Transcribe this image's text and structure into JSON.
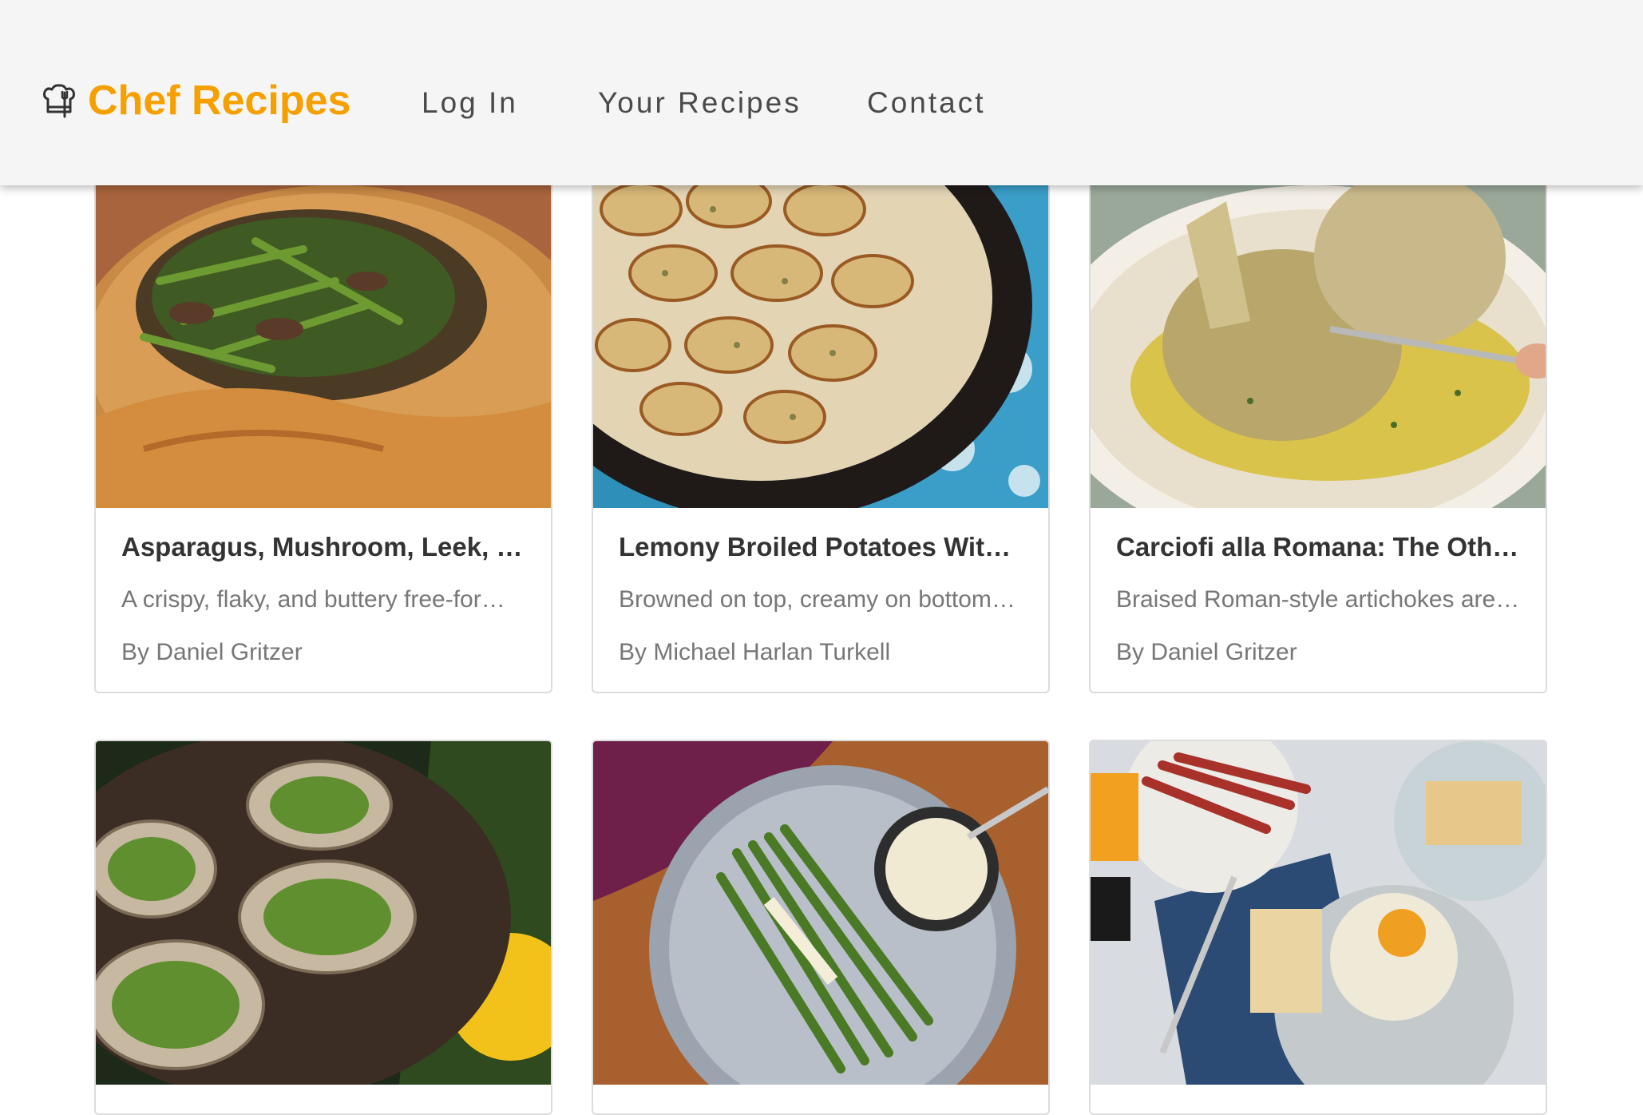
{
  "header": {
    "brand_name": "Chef Recipes",
    "brand_icon": "chef-hat-icon",
    "brand_color": "#f5a000",
    "nav": [
      {
        "label": "Log In"
      },
      {
        "label": "Your Recipes"
      },
      {
        "label": "Contact"
      }
    ]
  },
  "recipes": [
    {
      "title": "Asparagus, Mushroom, Leek, a…",
      "description": "A crispy, flaky, and buttery free-for…",
      "author": "By Daniel Gritzer",
      "image": "asparagus-mushroom-galette-photo"
    },
    {
      "title": "Lemony Broiled Potatoes With …",
      "description": "Browned on top, creamy on bottom…",
      "author": "By Michael Harlan Turkell",
      "image": "broiled-potatoes-skillet-photo"
    },
    {
      "title": "Carciofi alla Romana: The Othe…",
      "description": "Braised Roman-style artichokes are …",
      "author": "By Daniel Gritzer",
      "image": "braised-artichokes-plate-photo"
    },
    {
      "title": "",
      "description": "",
      "author": "",
      "image": "grilled-oysters-photo"
    },
    {
      "title": "",
      "description": "",
      "author": "",
      "image": "asparagus-with-sauce-photo"
    },
    {
      "title": "",
      "description": "",
      "author": "",
      "image": "breakfast-coddled-egg-photo"
    }
  ]
}
